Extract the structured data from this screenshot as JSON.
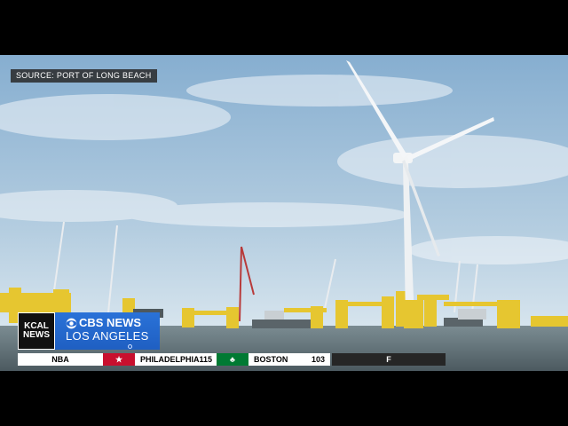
{
  "source": "SOURCE: PORT OF LONG BEACH",
  "bug": {
    "station_line1": "KCAL",
    "station_line2": "NEWS",
    "network": "CBS NEWS",
    "city": "LOS ANGELES",
    "eye_icon": "cbs-eye-icon"
  },
  "ticker": {
    "league": "NBA",
    "team1": {
      "name": "PHILADELPHIA",
      "score": "115",
      "logo": "76ers-logo-icon"
    },
    "team2": {
      "name": "BOSTON",
      "score": "103",
      "logo": "celtics-logo-icon"
    },
    "status": "F"
  },
  "colors": {
    "sky_top": "#8fb7d6",
    "sky_horizon": "#e4eef4",
    "water": "#5e6e74",
    "platform_yellow": "#e8c935",
    "cbs_blue": "#2468d0",
    "sixers_red": "#c8102e",
    "celtics_green": "#007a33"
  }
}
